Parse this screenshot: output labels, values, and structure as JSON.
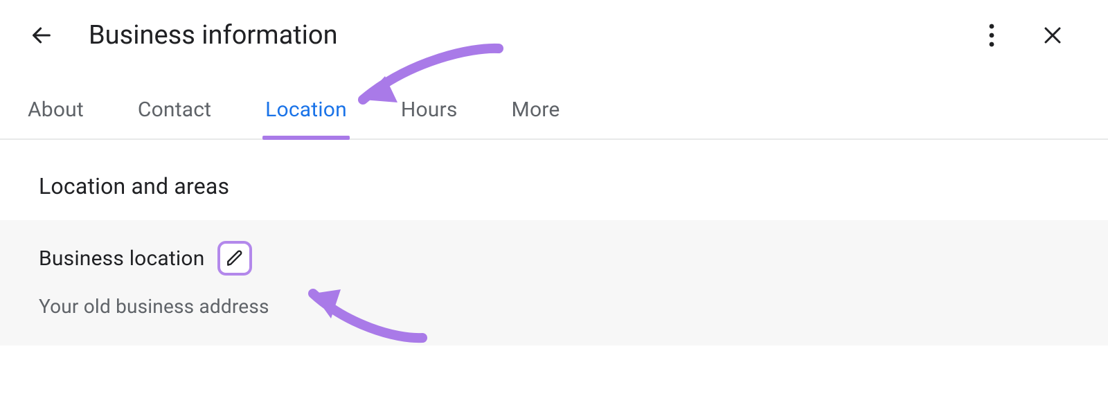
{
  "header": {
    "title": "Business information"
  },
  "tabs": {
    "items": [
      {
        "label": "About"
      },
      {
        "label": "Contact"
      },
      {
        "label": "Location"
      },
      {
        "label": "Hours"
      },
      {
        "label": "More"
      }
    ],
    "activeIndex": 2
  },
  "section": {
    "heading": "Location and areas",
    "row": {
      "title": "Business location",
      "subtitle": "Your old business address"
    }
  },
  "colors": {
    "annotation": "#a97ae8",
    "activeTab": "#1a73e8",
    "secondaryText": "#5f6368"
  }
}
